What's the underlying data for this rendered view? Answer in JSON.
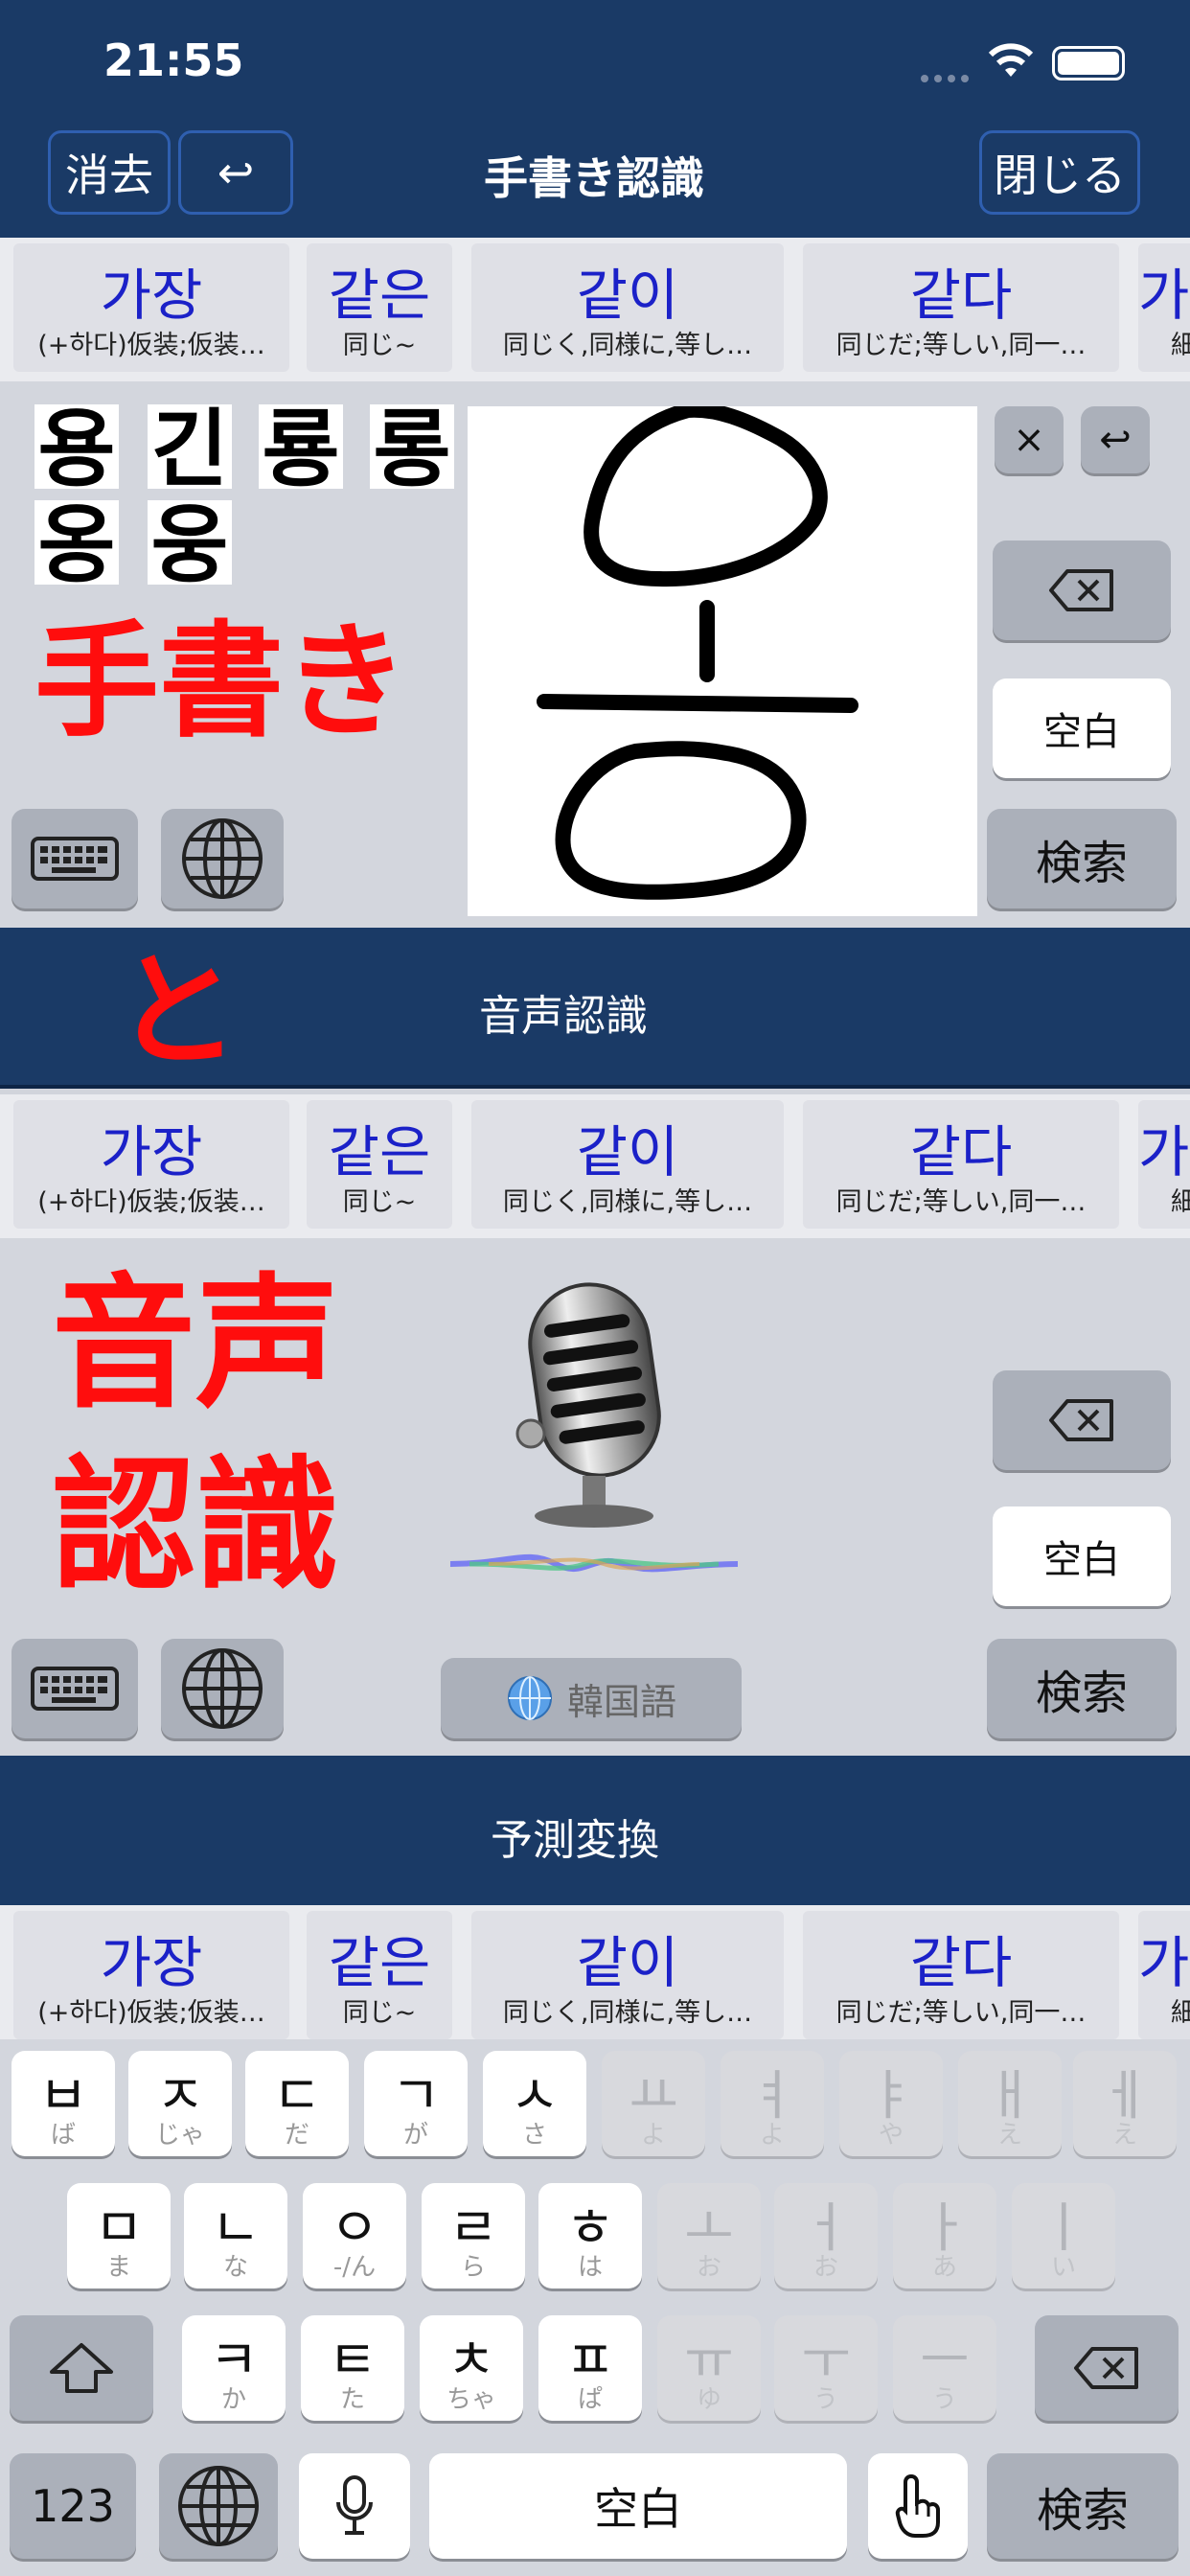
{
  "status_bar": {
    "time": "21:55"
  },
  "header": {
    "clear_label": "消去",
    "undo_label": "↩",
    "title": "手書き認識",
    "close_label": "閉じる"
  },
  "candidates": [
    {
      "word": "가장",
      "meaning": "(+하다)仮装;仮装…"
    },
    {
      "word": "같은",
      "meaning": "同じ~"
    },
    {
      "word": "같이",
      "meaning": "同じく,同様に,等し…"
    },
    {
      "word": "같다",
      "meaning": "同じだ;等しい,同一…"
    },
    {
      "word": "가",
      "meaning": "細"
    }
  ],
  "handwriting": {
    "results": [
      "용",
      "긴",
      "룡",
      "롱",
      "옹",
      "웅"
    ],
    "overlay_label": "手書き",
    "keys": {
      "close": "×",
      "return": "↩",
      "space": "空白",
      "search": "検索"
    }
  },
  "connector_label": "と",
  "voice": {
    "title": "音声認識",
    "overlay_line1": "音声",
    "overlay_line2": "認識",
    "language_label": "韓国語",
    "keys": {
      "space": "空白",
      "search": "検索"
    }
  },
  "prediction": {
    "title": "予測変換"
  },
  "keyboard": {
    "row1": [
      {
        "c": "ㅂ",
        "h": "ば",
        "dim": false
      },
      {
        "c": "ㅈ",
        "h": "じゃ",
        "dim": false
      },
      {
        "c": "ㄷ",
        "h": "だ",
        "dim": false
      },
      {
        "c": "ㄱ",
        "h": "が",
        "dim": false
      },
      {
        "c": "ㅅ",
        "h": "さ",
        "dim": false
      },
      {
        "c": "ㅛ",
        "h": "よ",
        "dim": true
      },
      {
        "c": "ㅕ",
        "h": "よ",
        "dim": true
      },
      {
        "c": "ㅑ",
        "h": "や",
        "dim": true
      },
      {
        "c": "ㅐ",
        "h": "え",
        "dim": true
      },
      {
        "c": "ㅔ",
        "h": "え",
        "dim": true
      }
    ],
    "row2": [
      {
        "c": "ㅁ",
        "h": "ま",
        "dim": false
      },
      {
        "c": "ㄴ",
        "h": "な",
        "dim": false
      },
      {
        "c": "ㅇ",
        "h": "-/ん",
        "dim": false
      },
      {
        "c": "ㄹ",
        "h": "ら",
        "dim": false
      },
      {
        "c": "ㅎ",
        "h": "は",
        "dim": false
      },
      {
        "c": "ㅗ",
        "h": "お",
        "dim": true
      },
      {
        "c": "ㅓ",
        "h": "お",
        "dim": true
      },
      {
        "c": "ㅏ",
        "h": "あ",
        "dim": true
      },
      {
        "c": "ㅣ",
        "h": "い",
        "dim": true
      }
    ],
    "row3": [
      {
        "c": "ㅋ",
        "h": "か",
        "dim": false
      },
      {
        "c": "ㅌ",
        "h": "た",
        "dim": false
      },
      {
        "c": "ㅊ",
        "h": "ちゃ",
        "dim": false
      },
      {
        "c": "ㅍ",
        "h": "ぱ",
        "dim": false
      },
      {
        "c": "ㅠ",
        "h": "ゆ",
        "dim": true
      },
      {
        "c": "ㅜ",
        "h": "う",
        "dim": true
      },
      {
        "c": "ㅡ",
        "h": "う",
        "dim": true
      }
    ],
    "numbers_label": "123",
    "space_label": "空白",
    "search_label": "検索"
  }
}
